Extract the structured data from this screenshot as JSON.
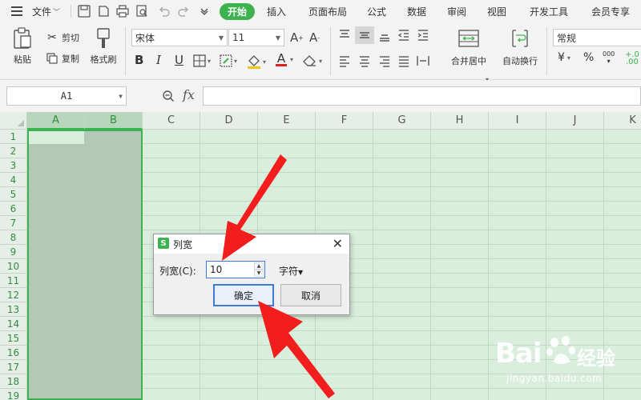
{
  "menubar": {
    "file": "文件",
    "tabs": [
      "开始",
      "插入",
      "页面布局",
      "公式",
      "数据",
      "审阅",
      "视图",
      "开发工具",
      "会员专享"
    ],
    "active_tab": "开始"
  },
  "ribbon": {
    "paste": "粘贴",
    "cut": "剪切",
    "copy": "复制",
    "format_painter": "格式刷",
    "font_name": "宋体",
    "font_size": "11",
    "bold": "B",
    "italic": "I",
    "underline": "U",
    "font_color_glyph": "A",
    "merge_center": "合并居中",
    "wrap_text": "自动换行",
    "number_format": "常规",
    "currency": "¥",
    "percent": "%",
    "thousands": "000"
  },
  "formula_bar": {
    "name_box": "A1",
    "fx": "fx",
    "formula": ""
  },
  "sheet": {
    "columns": [
      "A",
      "B",
      "C",
      "D",
      "E",
      "F",
      "G",
      "H",
      "I",
      "J",
      "K"
    ],
    "rows": [
      "1",
      "2",
      "3",
      "4",
      "5",
      "6",
      "7",
      "8",
      "9",
      "10",
      "11",
      "12",
      "13",
      "14",
      "15",
      "16",
      "17",
      "18",
      "19"
    ],
    "selected_columns": [
      "A",
      "B"
    ]
  },
  "dialog": {
    "logo": "S",
    "title": "列宽",
    "label": "列宽(C):",
    "value": "10",
    "unit": "字符",
    "ok": "确定",
    "cancel": "取消"
  },
  "watermark": {
    "brand": "Bai",
    "brand2": "经验",
    "url": "jingyan.baidu.com"
  },
  "colors": {
    "accent": "#3db34f",
    "sheet_bg": "#d9eedd",
    "selection": "#b3c8b6",
    "arrow": "#f21d1d"
  }
}
